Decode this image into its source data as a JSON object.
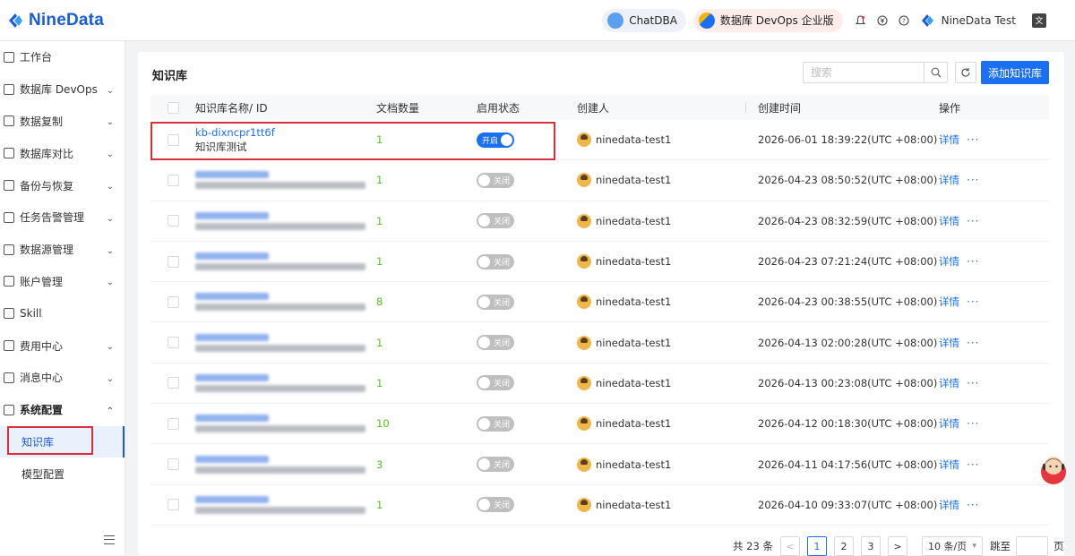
{
  "brand": {
    "name": "NineData"
  },
  "header": {
    "chatdba": "ChatDBA",
    "devops": "数据库 DevOps 企业版",
    "user": "NineData Test",
    "lang_icon": "translate-icon"
  },
  "sidebar": {
    "items": [
      {
        "label": "工作台",
        "icon": "home-icon",
        "expandable": false
      },
      {
        "label": "数据库 DevOps",
        "icon": "devops-icon",
        "expandable": true
      },
      {
        "label": "数据复制",
        "icon": "replication-icon",
        "expandable": true
      },
      {
        "label": "数据库对比",
        "icon": "compare-icon",
        "expandable": true
      },
      {
        "label": "备份与恢复",
        "icon": "backup-icon",
        "expandable": true
      },
      {
        "label": "任务告警管理",
        "icon": "alert-icon",
        "expandable": true
      },
      {
        "label": "数据源管理",
        "icon": "datasource-icon",
        "expandable": true
      },
      {
        "label": "账户管理",
        "icon": "account-icon",
        "expandable": true
      },
      {
        "label": "Skill",
        "icon": "skill-icon",
        "expandable": false
      },
      {
        "label": "费用中心",
        "icon": "billing-icon",
        "expandable": true
      },
      {
        "label": "消息中心",
        "icon": "message-icon",
        "expandable": true
      }
    ],
    "group": {
      "label": "系统配置",
      "icon": "settings-icon",
      "expanded": true
    },
    "sub_items": [
      {
        "label": "知识库",
        "active": true
      },
      {
        "label": "模型配置",
        "active": false
      }
    ]
  },
  "main": {
    "title": "知识库",
    "search_placeholder": "搜索",
    "add_button": "添加知识库",
    "columns": {
      "name": "知识库名称/ ID",
      "docs": "文档数量",
      "status": "启用状态",
      "owner": "创建人",
      "time": "创建时间",
      "ops": "操作"
    },
    "rows": [
      {
        "id": "kb-dixncpr1tt6f",
        "desc": "知识库测试",
        "docs": "1",
        "enabled": true,
        "toggle": "开启",
        "owner": "ninedata-test1",
        "time": "2026-06-01 18:39:22(UTC +08:00)",
        "op": "详情",
        "more": "···",
        "blurred": false
      },
      {
        "docs": "1",
        "enabled": false,
        "toggle": "关闭",
        "owner": "ninedata-test1",
        "time": "2026-04-23 08:50:52(UTC +08:00)",
        "op": "详情",
        "more": "···",
        "blurred": true
      },
      {
        "docs": "1",
        "enabled": false,
        "toggle": "关闭",
        "owner": "ninedata-test1",
        "time": "2026-04-23 08:32:59(UTC +08:00)",
        "op": "详情",
        "more": "···",
        "blurred": true
      },
      {
        "docs": "1",
        "enabled": false,
        "toggle": "关闭",
        "owner": "ninedata-test1",
        "time": "2026-04-23 07:21:24(UTC +08:00)",
        "op": "详情",
        "more": "···",
        "blurred": true
      },
      {
        "docs": "8",
        "enabled": false,
        "toggle": "关闭",
        "owner": "ninedata-test1",
        "time": "2026-04-23 00:38:55(UTC +08:00)",
        "op": "详情",
        "more": "···",
        "blurred": true
      },
      {
        "docs": "1",
        "enabled": false,
        "toggle": "关闭",
        "owner": "ninedata-test1",
        "time": "2026-04-13 02:00:28(UTC +08:00)",
        "op": "详情",
        "more": "···",
        "blurred": true
      },
      {
        "docs": "1",
        "enabled": false,
        "toggle": "关闭",
        "owner": "ninedata-test1",
        "time": "2026-04-13 00:23:08(UTC +08:00)",
        "op": "详情",
        "more": "···",
        "blurred": true
      },
      {
        "docs": "10",
        "enabled": false,
        "toggle": "关闭",
        "owner": "ninedata-test1",
        "time": "2026-04-12 00:18:30(UTC +08:00)",
        "op": "详情",
        "more": "···",
        "blurred": true
      },
      {
        "docs": "3",
        "enabled": false,
        "toggle": "关闭",
        "owner": "ninedata-test1",
        "time": "2026-04-11 04:17:56(UTC +08:00)",
        "op": "详情",
        "more": "···",
        "blurred": true
      },
      {
        "docs": "1",
        "enabled": false,
        "toggle": "关闭",
        "owner": "ninedata-test1",
        "time": "2026-04-10 09:33:07(UTC +08:00)",
        "op": "详情",
        "more": "···",
        "blurred": true
      }
    ]
  },
  "pagination": {
    "total": "共 23 条",
    "prev": "<",
    "pages": [
      "1",
      "2",
      "3"
    ],
    "current": "1",
    "next": ">",
    "page_size": "10 条/页",
    "jump_label": "跳至",
    "page_label": "页"
  },
  "colors": {
    "accent": "#1a6ff2",
    "success": "#52c41a",
    "highlight": "#d9303a"
  }
}
